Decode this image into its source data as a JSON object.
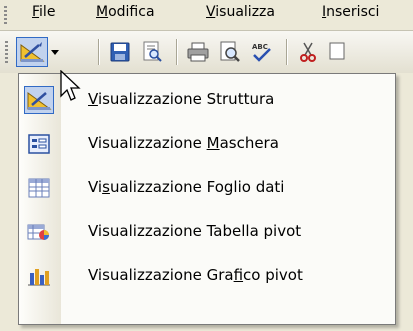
{
  "menubar": {
    "items": [
      {
        "pre": "",
        "ul": "F",
        "post": "ile"
      },
      {
        "pre": "",
        "ul": "M",
        "post": "odifica"
      },
      {
        "pre": "",
        "ul": "V",
        "post": "isualizza"
      },
      {
        "pre": "",
        "ul": "I",
        "post": "nserisci"
      }
    ]
  },
  "toolbar": {
    "buttons": [
      "view-design-icon",
      "save-icon",
      "search-database-icon",
      "print-icon",
      "print-preview-icon",
      "spelling-icon",
      "cut-icon"
    ]
  },
  "view_menu": {
    "items": [
      {
        "pre": "",
        "ul": "V",
        "post": "isualizzazione Struttura",
        "icon": "design-view-icon",
        "selected": true
      },
      {
        "pre": "Visualizzazione ",
        "ul": "M",
        "post": "aschera",
        "icon": "form-view-icon",
        "selected": false
      },
      {
        "pre": "Vi",
        "ul": "s",
        "post": "ualizzazione Foglio dati",
        "icon": "datasheet-view-icon",
        "selected": false
      },
      {
        "pre": "Visualizzazione Tabella pivot",
        "ul": "",
        "post": "",
        "icon": "pivottable-view-icon",
        "selected": false
      },
      {
        "pre": "Visualizzazione Gra",
        "ul": "f",
        "post": "ico pivot",
        "icon": "pivotchart-view-icon",
        "selected": false
      }
    ]
  },
  "colors": {
    "highlight": "#c1d2ee",
    "highlight_border": "#316ac5",
    "menubar_bg": "#ece9d8"
  }
}
